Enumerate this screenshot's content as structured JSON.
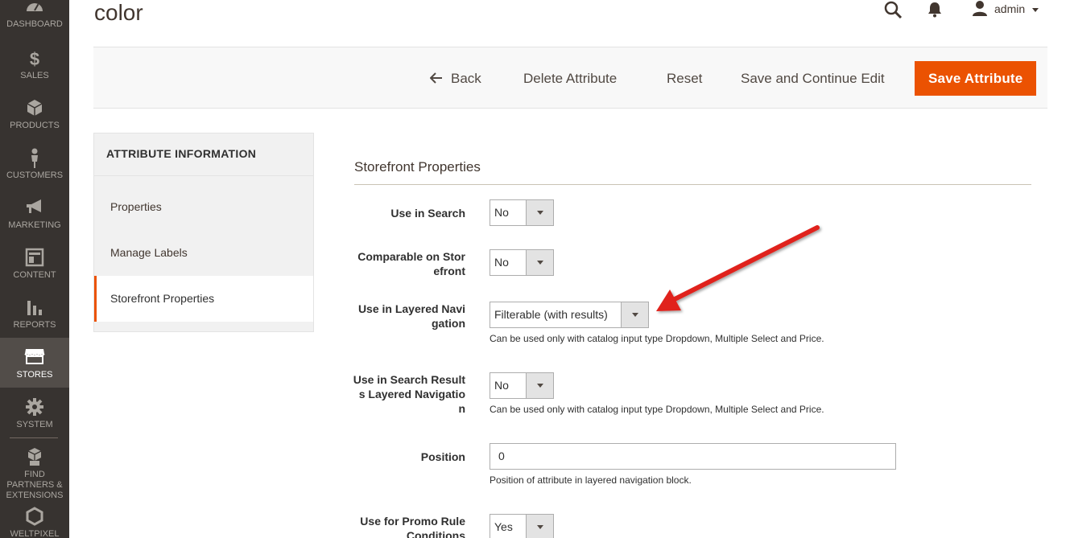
{
  "sidebar": {
    "items": [
      {
        "label": "DASHBOARD",
        "icon": "dashboard-icon"
      },
      {
        "label": "SALES",
        "icon": "dollar-icon"
      },
      {
        "label": "PRODUCTS",
        "icon": "cube-icon"
      },
      {
        "label": "CUSTOMERS",
        "icon": "person-icon"
      },
      {
        "label": "MARKETING",
        "icon": "megaphone-icon"
      },
      {
        "label": "CONTENT",
        "icon": "layout-icon"
      },
      {
        "label": "REPORTS",
        "icon": "bar-chart-icon"
      },
      {
        "label": "STORES",
        "icon": "storefront-icon"
      },
      {
        "label": "SYSTEM",
        "icon": "gear-icon"
      },
      {
        "label": "FIND PARTNERS & EXTENSIONS",
        "icon": "boxes-icon"
      },
      {
        "label": "WELTPIXEL",
        "icon": "hexagon-icon"
      }
    ],
    "active": "STORES",
    "active_bg": "#524d49"
  },
  "header": {
    "title": "color",
    "user": "admin"
  },
  "toolbar": {
    "back_label": "Back",
    "delete_label": "Delete Attribute",
    "reset_label": "Reset",
    "save_continue_label": "Save and Continue Edit",
    "save_label": "Save Attribute",
    "primary_color": "#eb5202"
  },
  "tabs": {
    "title": "ATTRIBUTE INFORMATION",
    "items": [
      "Properties",
      "Manage Labels",
      "Storefront Properties"
    ],
    "active": "Storefront Properties"
  },
  "form": {
    "section_title": "Storefront Properties",
    "fields": {
      "use_in_search": {
        "label": "Use in Search",
        "value": "No"
      },
      "comparable": {
        "label_1": "Comparable on Stor",
        "label_2": "efront",
        "value": "No"
      },
      "layered_nav": {
        "label_1": "Use in Layered Navi",
        "label_2": "gation",
        "value": "Filterable (with results)",
        "note": "Can be used only with catalog input type Dropdown, Multiple Select and Price."
      },
      "search_layered_nav": {
        "label_1": "Use in Search Result",
        "label_2": "s Layered Navigatio",
        "label_3": "n",
        "value": "No",
        "note": "Can be used only with catalog input type Dropdown, Multiple Select and Price."
      },
      "position": {
        "label": "Position",
        "value": "0",
        "note": "Position of attribute in layered navigation block."
      },
      "promo_rule": {
        "label_1": "Use for Promo Rule",
        "label_2": "Conditions",
        "value": "Yes"
      }
    }
  },
  "annotation_color": "#e0201a"
}
